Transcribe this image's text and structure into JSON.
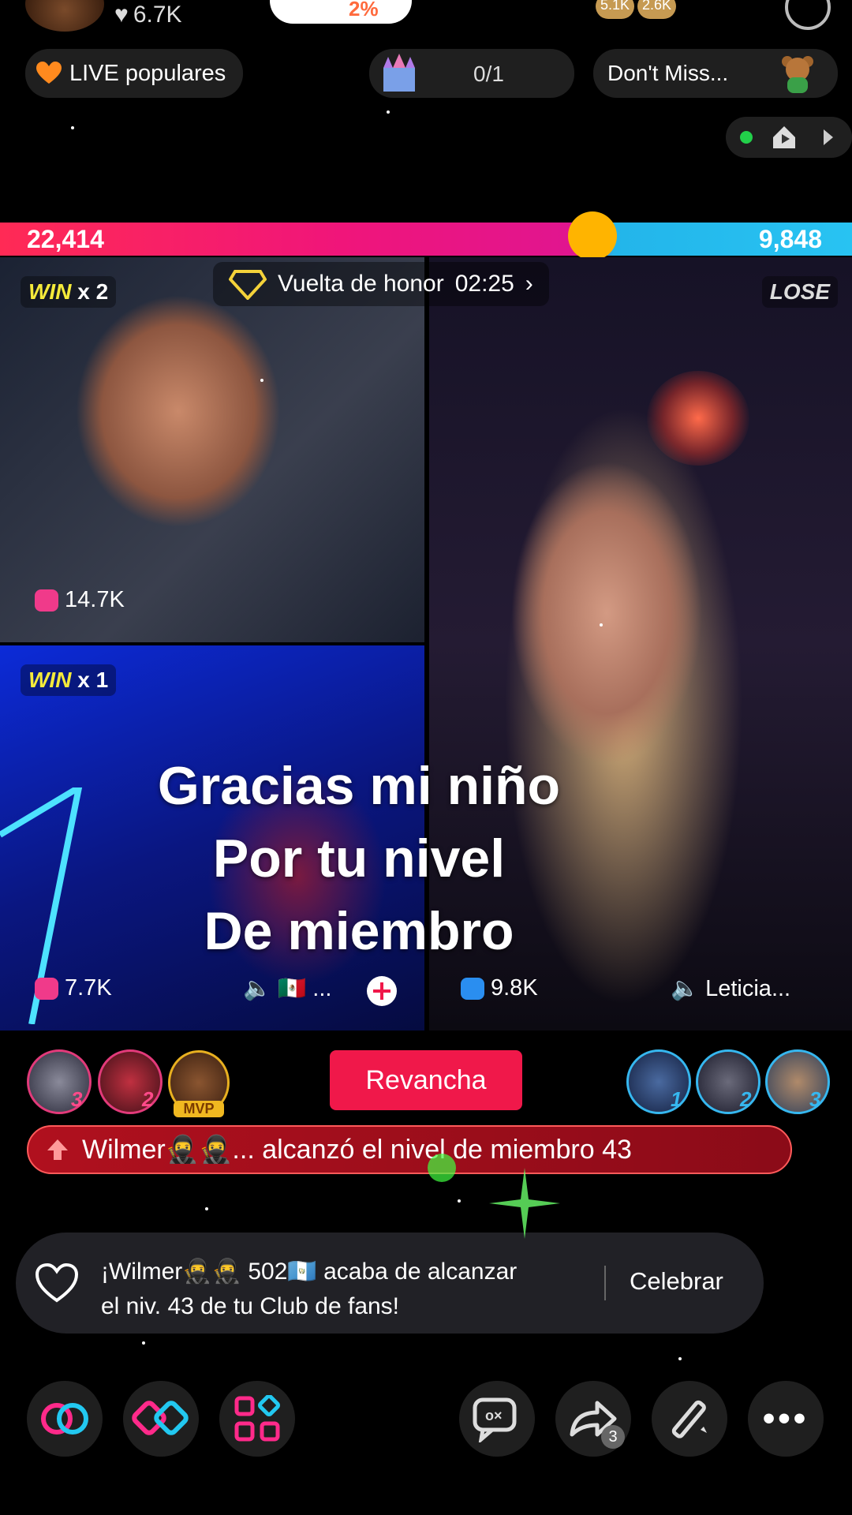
{
  "header": {
    "likes": "6.7K",
    "badge_value": "2%",
    "viewer_counts": [
      "5.1K",
      "2.6K"
    ]
  },
  "chips": {
    "live_populares": "LIVE populares",
    "progress": "0/1",
    "dont_miss": "Don't Miss..."
  },
  "battle": {
    "score_left": "22,414",
    "score_right": "9,848",
    "honor_label": "Vuelta de honor",
    "honor_timer": "02:25",
    "win1_word": "WIN",
    "win1_mult": "x 2",
    "win2_word": "WIN",
    "win2_mult": "x 1",
    "lose": "LOSE",
    "p1_score": "14.7K",
    "p2_score": "7.7K",
    "p2_name": "🇲🇽 ...",
    "p3_score": "9.8K",
    "p3_name": "Leticia..."
  },
  "overlay": {
    "line1": "Gracias mi niño",
    "line2": "Por tu nivel",
    "line3": "De miembro"
  },
  "ranking": {
    "left": [
      "3",
      "2",
      "MVP"
    ],
    "revancha": "Revancha",
    "right": [
      "1",
      "2",
      "3"
    ]
  },
  "member_banner": "Wilmer🥷🥷... alcanzó el nivel de miembro 43",
  "fan_club": {
    "line1": "¡Wilmer🥷🥷 502🇬🇹 acaba de alcanzar",
    "line2": "el niv. 43 de tu Club de fans!",
    "celebrate": "Celebrar"
  },
  "bottom": {
    "share_count": "3"
  },
  "colors": {
    "battle_red": "#f0157a",
    "battle_blue": "#28c3f2",
    "accent_red": "#f0184a",
    "win_yellow": "#f4ea3a"
  }
}
